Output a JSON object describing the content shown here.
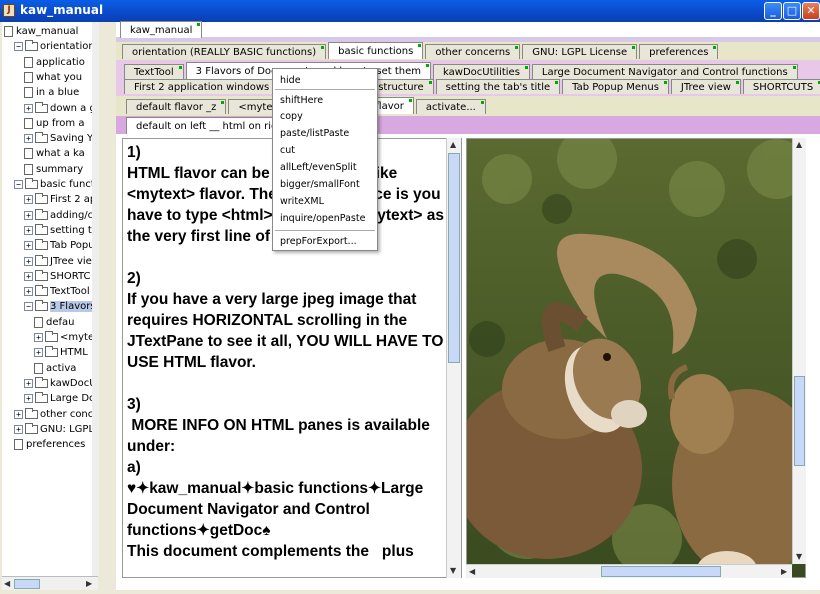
{
  "window": {
    "title": "kaw_manual"
  },
  "tree": {
    "items": [
      {
        "label": "kaw_manual",
        "type": "doc",
        "indent": 0,
        "toggle": ""
      },
      {
        "label": "orientation (R",
        "type": "folder",
        "indent": 1,
        "toggle": "−"
      },
      {
        "label": "applicatio",
        "type": "doc",
        "indent": 2,
        "toggle": ""
      },
      {
        "label": "what you",
        "type": "doc",
        "indent": 2,
        "toggle": ""
      },
      {
        "label": "in a blue",
        "type": "doc",
        "indent": 2,
        "toggle": ""
      },
      {
        "label": "down a g",
        "type": "folder",
        "indent": 2,
        "toggle": "+"
      },
      {
        "label": "up from a",
        "type": "doc",
        "indent": 2,
        "toggle": ""
      },
      {
        "label": "Saving Yo",
        "type": "folder",
        "indent": 2,
        "toggle": "+"
      },
      {
        "label": "what a ka",
        "type": "doc",
        "indent": 2,
        "toggle": ""
      },
      {
        "label": "summary",
        "type": "doc",
        "indent": 2,
        "toggle": ""
      },
      {
        "label": "basic functio",
        "type": "folder",
        "indent": 1,
        "toggle": "−"
      },
      {
        "label": "First 2 ap",
        "type": "folder",
        "indent": 2,
        "toggle": "+"
      },
      {
        "label": "adding/ch",
        "type": "folder",
        "indent": 2,
        "toggle": "+"
      },
      {
        "label": "setting th",
        "type": "folder",
        "indent": 2,
        "toggle": "+"
      },
      {
        "label": "Tab Popu",
        "type": "folder",
        "indent": 2,
        "toggle": "+"
      },
      {
        "label": "JTree vie",
        "type": "folder",
        "indent": 2,
        "toggle": "+"
      },
      {
        "label": "SHORTC",
        "type": "folder",
        "indent": 2,
        "toggle": "+"
      },
      {
        "label": "TextTool",
        "type": "folder",
        "indent": 2,
        "toggle": "+"
      },
      {
        "label": "3 Flavors",
        "type": "folder",
        "indent": 2,
        "toggle": "−",
        "selected": true
      },
      {
        "label": "defau",
        "type": "doc",
        "indent": 3,
        "toggle": ""
      },
      {
        "label": "<myte",
        "type": "folder",
        "indent": 3,
        "toggle": "+"
      },
      {
        "label": "HTML",
        "type": "folder",
        "indent": 3,
        "toggle": "+"
      },
      {
        "label": "activa",
        "type": "doc",
        "indent": 3,
        "toggle": ""
      },
      {
        "label": "kawDocU",
        "type": "folder",
        "indent": 2,
        "toggle": "+"
      },
      {
        "label": "Large Do",
        "type": "folder",
        "indent": 2,
        "toggle": "+"
      },
      {
        "label": "other concer",
        "type": "folder",
        "indent": 1,
        "toggle": "+"
      },
      {
        "label": "GNU: LGPL l",
        "type": "folder",
        "indent": 1,
        "toggle": "+"
      },
      {
        "label": "preferences",
        "type": "doc",
        "indent": 1,
        "toggle": ""
      }
    ]
  },
  "colorbar": [
    "#00c8d8",
    "#00c040",
    "#0000e0",
    "#f8f800"
  ],
  "tabs": {
    "row0": [
      {
        "label": "kaw_manual",
        "active": true
      }
    ],
    "row1": [
      {
        "label": "orientation (REALLY BASIC functions)"
      },
      {
        "label": "basic functions",
        "active": true
      },
      {
        "label": "other concerns"
      },
      {
        "label": "GNU: LGPL License"
      },
      {
        "label": "preferences"
      }
    ],
    "row2": [
      {
        "label": "TextTool"
      },
      {
        "label": "3 Flavors of Documents and how to set them",
        "active": true
      },
      {
        "label": "kawDocUtilities"
      },
      {
        "label": "Large Document Navigator and Control functions"
      }
    ],
    "row3": [
      {
        "label": "First 2 application windows"
      },
      {
        "label": "adding/changing structure"
      },
      {
        "label": "setting the tab's title"
      },
      {
        "label": "Tab Popup Menus"
      },
      {
        "label": "JTree view"
      },
      {
        "label": "SHORTCUTS"
      }
    ],
    "row4": [
      {
        "label": "default flavor _z"
      },
      {
        "label": "<mytext> flavor"
      },
      {
        "label": "HTML flavor",
        "active": true
      },
      {
        "label": "activate..."
      }
    ],
    "row5": [
      {
        "label": "default on left __ html on right",
        "active": true
      }
    ]
  },
  "popup": {
    "items": [
      "hide",
      "shiftHere",
      "copy",
      "paste/listPaste",
      "cut",
      "allLeft/evenSplit",
      "bigger/smallFont",
      "writeXML",
      "inquire/openPaste",
      "prepForExport..."
    ]
  },
  "textpane": {
    "text": "1)\nHTML flavor can be used exactly like <mytext> flavor. The only difference is you have to type <html> instead of <mytext> as the very first line of a textPane.\n\n2)\nIf you have a very large jpeg image that requires HORIZONTAL scrolling in the JTextPane to see it all, YOU WILL HAVE TO USE HTML flavor.\n\n3)\n MORE INFO ON HTML panes is available under:\na)\n♥✦kaw_manual✦basic functions✦Large Document Navigator and Control functions✦getDoc♠\nThis document complements the   plus"
  }
}
